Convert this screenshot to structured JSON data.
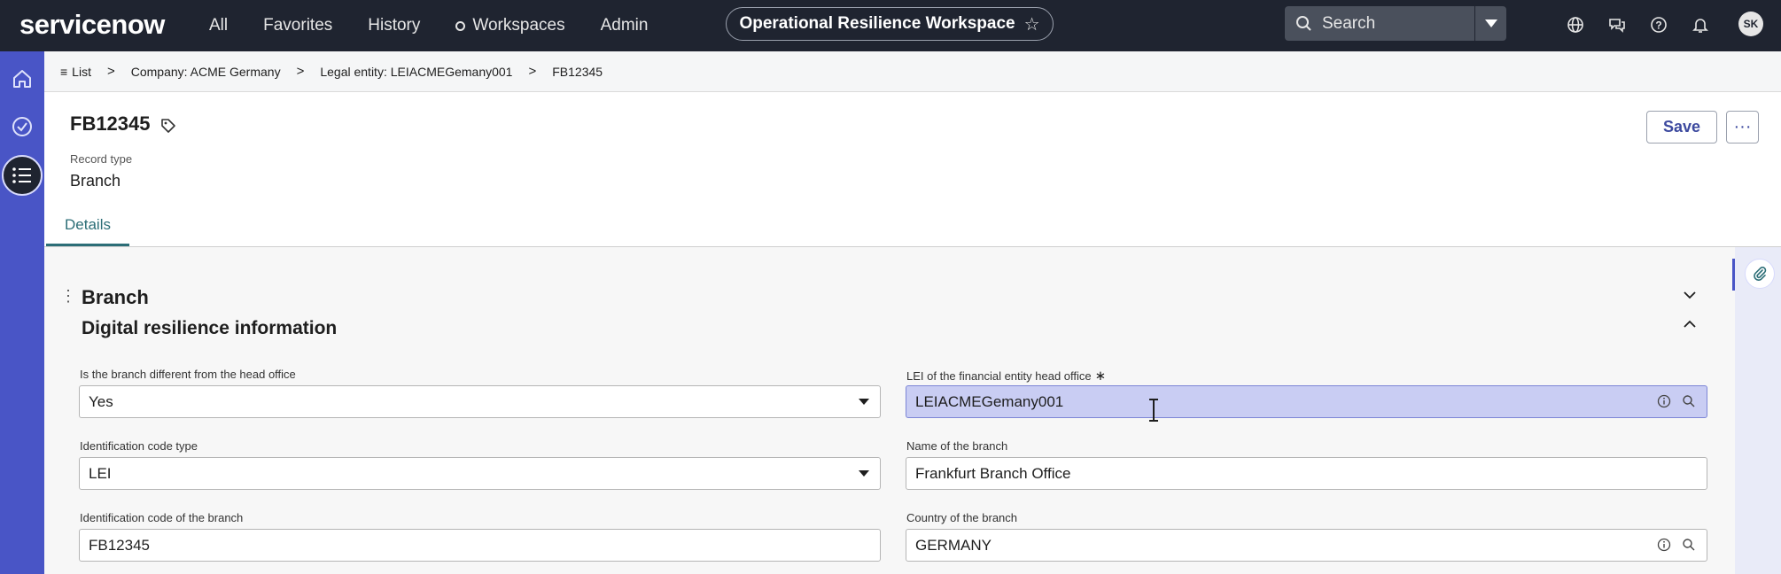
{
  "header": {
    "logo": "servicenow",
    "nav": [
      "All",
      "Favorites",
      "History",
      "Workspaces",
      "Admin"
    ],
    "workspace_title": "Operational Resilience Workspace",
    "search_placeholder": "Search",
    "avatar_initials": "SK"
  },
  "breadcrumb": {
    "list_label": "List",
    "items": [
      "Company: ACME Germany",
      "Legal entity: LEIACMEGemany001",
      "FB12345"
    ]
  },
  "record": {
    "title": "FB12345",
    "record_type_label": "Record type",
    "record_type_value": "Branch",
    "save_label": "Save",
    "more_label": "···"
  },
  "tabs": [
    "Details"
  ],
  "section": {
    "title": "Branch",
    "subtitle": "Digital resilience information"
  },
  "fields": {
    "branch_different": {
      "label": "Is the branch different from the head office",
      "value": "Yes"
    },
    "lei_head_office": {
      "label": "LEI of the financial entity head office",
      "required_mark": "∗",
      "value": "LEIACMEGemany001"
    },
    "id_code_type": {
      "label": "Identification code type",
      "value": "LEI"
    },
    "branch_name": {
      "label": "Name of the branch",
      "value": "Frankfurt Branch Office"
    },
    "id_code_branch": {
      "label": "Identification code of the branch",
      "value": "FB12345"
    },
    "country": {
      "label": "Country of the branch",
      "value": "GERMANY"
    }
  },
  "colors": {
    "header_bg": "#1f2430",
    "rail_bg": "#4955c6",
    "accent": "#2c6e77",
    "highlight_field": "#c9cdf3"
  }
}
